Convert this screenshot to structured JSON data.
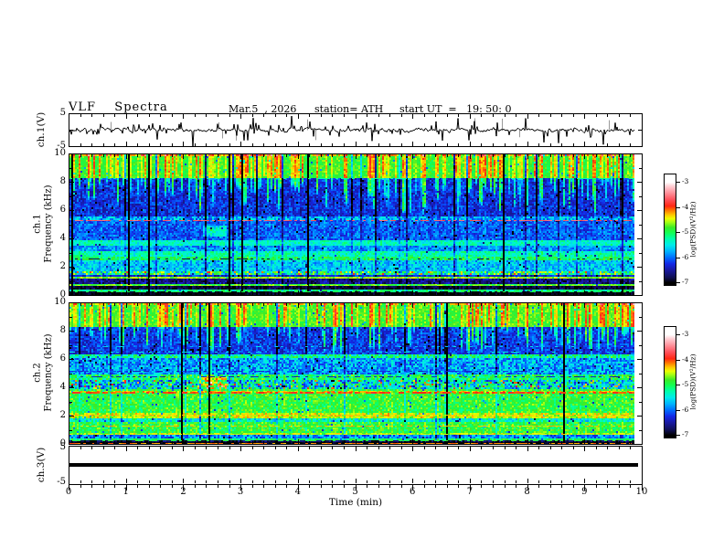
{
  "header": {
    "title": "VLF  Spectra",
    "date": "Mar.5  , 2026",
    "station": "station= ATH",
    "start_ut": "start UT  =   19: 50: 0"
  },
  "x_axis": {
    "label": "Time  (min)",
    "range_min": [
      0,
      10
    ],
    "major_ticks": [
      "0",
      "1",
      "2",
      "3",
      "4",
      "5",
      "6",
      "7",
      "8",
      "9",
      "10"
    ],
    "minor_interval_min": 0.2,
    "data_end_min": 9.86
  },
  "panels": {
    "ch1_wave": {
      "ylabel": "ch.1(V)",
      "yticks": [
        "5",
        "-5"
      ],
      "ylim": [
        -5,
        5
      ]
    },
    "spec1": {
      "ylabel_line1": "ch.1",
      "ylabel_line2": "Frequency  (kHz)",
      "yticks": [
        "10",
        "8",
        "6",
        "4",
        "2",
        "0"
      ],
      "ylim": [
        0,
        10
      ]
    },
    "spec2": {
      "ylabel_line1": "ch.2",
      "ylabel_line2": "Frequency  (kHz)",
      "yticks": [
        "10",
        "8",
        "6",
        "4",
        "2",
        "0"
      ],
      "ylim": [
        0,
        10
      ]
    },
    "ch3_wave": {
      "ylabel": "ch.3(V)",
      "yticks": [
        "5",
        "-5"
      ],
      "ylim": [
        -5,
        5
      ]
    }
  },
  "colorbar": {
    "label": "log(PSD)(V²/Hz)",
    "ticks": [
      "-3",
      "-4",
      "-5",
      "-6",
      "-7"
    ],
    "value_range": [
      -7,
      -3
    ],
    "stops": [
      [
        -7.0,
        0,
        0,
        0
      ],
      [
        -6.8,
        15,
        15,
        80
      ],
      [
        -6.5,
        25,
        25,
        160
      ],
      [
        -6.25,
        20,
        40,
        230
      ],
      [
        -6.0,
        0,
        110,
        255
      ],
      [
        -5.75,
        0,
        180,
        255
      ],
      [
        -5.5,
        0,
        235,
        235
      ],
      [
        -5.25,
        0,
        255,
        170
      ],
      [
        -5.0,
        20,
        255,
        80
      ],
      [
        -4.8,
        60,
        235,
        40
      ],
      [
        -4.6,
        160,
        255,
        20
      ],
      [
        -4.45,
        235,
        255,
        0
      ],
      [
        -4.3,
        255,
        200,
        0
      ],
      [
        -4.1,
        255,
        110,
        0
      ],
      [
        -3.95,
        255,
        40,
        20
      ],
      [
        -3.7,
        255,
        80,
        90
      ],
      [
        -3.4,
        255,
        150,
        160
      ],
      [
        -3.15,
        255,
        210,
        215
      ],
      [
        -3.0,
        255,
        255,
        255
      ]
    ]
  },
  "chart_data": [
    {
      "id": "ch1_waveform",
      "type": "line",
      "ylabel": "ch.1(V)",
      "ylim": [
        -5,
        5
      ],
      "x_range_min": [
        0,
        10
      ],
      "baseline_v": 0,
      "noise_amplitude_v": 0.45,
      "medium_spikes": {
        "count": 70,
        "amp_v": [
          0.8,
          2.0
        ]
      },
      "large_spikes": {
        "count": 24,
        "amp_v": [
          2.2,
          4.5
        ]
      },
      "gray_spikes": {
        "count": 10,
        "amp_v": [
          2.0,
          4.0
        ]
      },
      "seed": 7
    },
    {
      "id": "ch1_spectrogram",
      "type": "heatmap",
      "ylabel": "Frequency (kHz)",
      "ylim": [
        0,
        10
      ],
      "x_range_min": [
        0,
        10
      ],
      "value_units": "log(PSD)(V²/Hz)",
      "value_range": [
        -7,
        -3
      ],
      "seed": 11,
      "streak_zone": [
        5.55,
        8.3
      ],
      "top_zone": [
        8.3,
        10
      ],
      "bands": [
        {
          "f_hi": 10.0,
          "f_lo": 9.85,
          "base": -4.5,
          "noise": 0.45
        },
        {
          "f_hi": 9.85,
          "f_lo": 8.3,
          "base": -4.85,
          "noise": 0.2
        },
        {
          "f_hi": 8.3,
          "f_lo": 5.55,
          "base": -6.25,
          "noise": 0.3
        },
        {
          "f_hi": 5.55,
          "f_lo": 5.3,
          "base": -5.8,
          "noise": 0.45
        },
        {
          "f_hi": 5.3,
          "f_lo": 3.95,
          "base": -6.05,
          "noise": 0.3
        },
        {
          "f_hi": 3.95,
          "f_lo": 3.55,
          "base": -5.35,
          "noise": 0.25
        },
        {
          "f_hi": 3.55,
          "f_lo": 3.1,
          "base": -5.85,
          "noise": 0.3
        },
        {
          "f_hi": 3.1,
          "f_lo": 2.8,
          "base": -5.3,
          "noise": 0.3
        },
        {
          "f_hi": 2.8,
          "f_lo": 2.5,
          "base": -5.05,
          "noise": 0.3
        },
        {
          "f_hi": 2.5,
          "f_lo": 1.75,
          "base": -5.65,
          "noise": 0.35
        },
        {
          "f_hi": 1.75,
          "f_lo": 1.5,
          "base": -5.2,
          "noise": 0.85
        },
        {
          "f_hi": 1.5,
          "f_lo": 1.36,
          "base": -6.3,
          "noise": 0.3
        },
        {
          "f_hi": 1.36,
          "f_lo": 1.22,
          "base": -4.65,
          "noise": 0.25
        },
        {
          "f_hi": 1.22,
          "f_lo": 0.85,
          "base": -6.6,
          "noise": 0.3
        },
        {
          "f_hi": 0.85,
          "f_lo": 0.7,
          "base": -4.85,
          "noise": 0.3
        },
        {
          "f_hi": 0.7,
          "f_lo": 0.42,
          "base": -6.85,
          "noise": 0.2
        },
        {
          "f_hi": 0.42,
          "f_lo": 0.28,
          "base": -5.15,
          "noise": 0.25
        },
        {
          "f_hi": 0.28,
          "f_lo": 0.0,
          "base": -6.95,
          "noise": 0.1
        }
      ],
      "h_lines": [
        {
          "f": 5.38,
          "value": -3.65,
          "p": 0.6,
          "w": 1
        },
        {
          "f": 8.3,
          "value": -5.2,
          "p": 0.35,
          "w": 1
        },
        {
          "f": 2.62,
          "value": -6.8,
          "p": 0.3,
          "w": 1
        },
        {
          "f": 1.28,
          "value": -4.5,
          "p": 0.5,
          "w": 1
        },
        {
          "f": 0.78,
          "value": -4.6,
          "p": 0.45,
          "w": 1
        },
        {
          "f": 0.35,
          "value": -5.0,
          "p": 0.5,
          "w": 1
        }
      ],
      "blob": {
        "t_min": 2.52,
        "f_khz": 4.6,
        "t_halfwidth": 0.22,
        "f_halfwidth": 0.35,
        "boost": 1.0
      }
    },
    {
      "id": "ch2_spectrogram",
      "type": "heatmap",
      "ylabel": "Frequency (kHz)",
      "ylim": [
        0,
        10
      ],
      "x_range_min": [
        0,
        10
      ],
      "value_units": "log(PSD)(V²/Hz)",
      "value_range": [
        -7,
        -3
      ],
      "seed": 23,
      "streak_zone": [
        6.35,
        8.35
      ],
      "top_zone": [
        8.35,
        10
      ],
      "bands": [
        {
          "f_hi": 10.0,
          "f_lo": 9.85,
          "base": -4.5,
          "noise": 0.45
        },
        {
          "f_hi": 9.85,
          "f_lo": 8.35,
          "base": -4.8,
          "noise": 0.2
        },
        {
          "f_hi": 8.35,
          "f_lo": 6.35,
          "base": -6.2,
          "noise": 0.3
        },
        {
          "f_hi": 6.35,
          "f_lo": 6.15,
          "base": -5.2,
          "noise": 0.45
        },
        {
          "f_hi": 6.15,
          "f_lo": 5.0,
          "base": -5.8,
          "noise": 0.45
        },
        {
          "f_hi": 5.0,
          "f_lo": 4.6,
          "base": -5.05,
          "noise": 0.4
        },
        {
          "f_hi": 4.6,
          "f_lo": 3.95,
          "base": -5.5,
          "noise": 0.8
        },
        {
          "f_hi": 3.95,
          "f_lo": 3.85,
          "base": -4.9,
          "noise": 0.3
        },
        {
          "f_hi": 3.85,
          "f_lo": 3.65,
          "base": -4.55,
          "noise": 0.45
        },
        {
          "f_hi": 3.65,
          "f_lo": 2.3,
          "base": -4.9,
          "noise": 0.3
        },
        {
          "f_hi": 2.3,
          "f_lo": 1.9,
          "base": -4.5,
          "noise": 0.3
        },
        {
          "f_hi": 1.9,
          "f_lo": 1.55,
          "base": -5.4,
          "noise": 0.45
        },
        {
          "f_hi": 1.55,
          "f_lo": 0.85,
          "base": -4.9,
          "noise": 0.3
        },
        {
          "f_hi": 0.85,
          "f_lo": 0.72,
          "base": -4.6,
          "noise": 0.35
        },
        {
          "f_hi": 0.72,
          "f_lo": 0.5,
          "base": -5.9,
          "noise": 0.45
        },
        {
          "f_hi": 0.5,
          "f_lo": 0.38,
          "base": -5.05,
          "noise": 0.25
        },
        {
          "f_hi": 0.38,
          "f_lo": 0.18,
          "base": -6.8,
          "noise": 0.25
        },
        {
          "f_hi": 0.18,
          "f_lo": 0.0,
          "base": -6.95,
          "noise": 0.1
        }
      ],
      "h_lines": [
        {
          "f": 3.72,
          "value": -4.0,
          "p": 0.7,
          "w": 2
        },
        {
          "f": 2.15,
          "value": -4.3,
          "p": 0.5,
          "w": 1
        },
        {
          "f": 5.2,
          "value": -6.3,
          "p": 0.4,
          "w": 1
        },
        {
          "f": 4.85,
          "value": -6.4,
          "p": 0.35,
          "w": 1
        },
        {
          "f": 7.0,
          "value": -5.6,
          "p": 0.2,
          "w": 1
        },
        {
          "f": 6.6,
          "value": -5.5,
          "p": 0.25,
          "w": 1
        },
        {
          "f": 1.35,
          "value": -4.3,
          "p": 0.5,
          "w": 1
        },
        {
          "f": 0.78,
          "value": -4.5,
          "p": 0.6,
          "w": 1
        },
        {
          "f": 0.3,
          "value": -4.9,
          "p": 0.4,
          "w": 1
        },
        {
          "f": 0.13,
          "value": -4.15,
          "p": 0.7,
          "w": 1
        }
      ],
      "blob": {
        "t_min": 2.47,
        "f_khz": 4.4,
        "t_halfwidth": 0.25,
        "f_halfwidth": 0.5,
        "boost": 1.1
      }
    },
    {
      "id": "ch3_waveform",
      "type": "line",
      "ylabel": "ch.3(V)",
      "ylim": [
        -5,
        5
      ],
      "x_range_min": [
        0,
        10
      ],
      "constant_value_v": 0,
      "line_thickness_px": 4
    }
  ]
}
